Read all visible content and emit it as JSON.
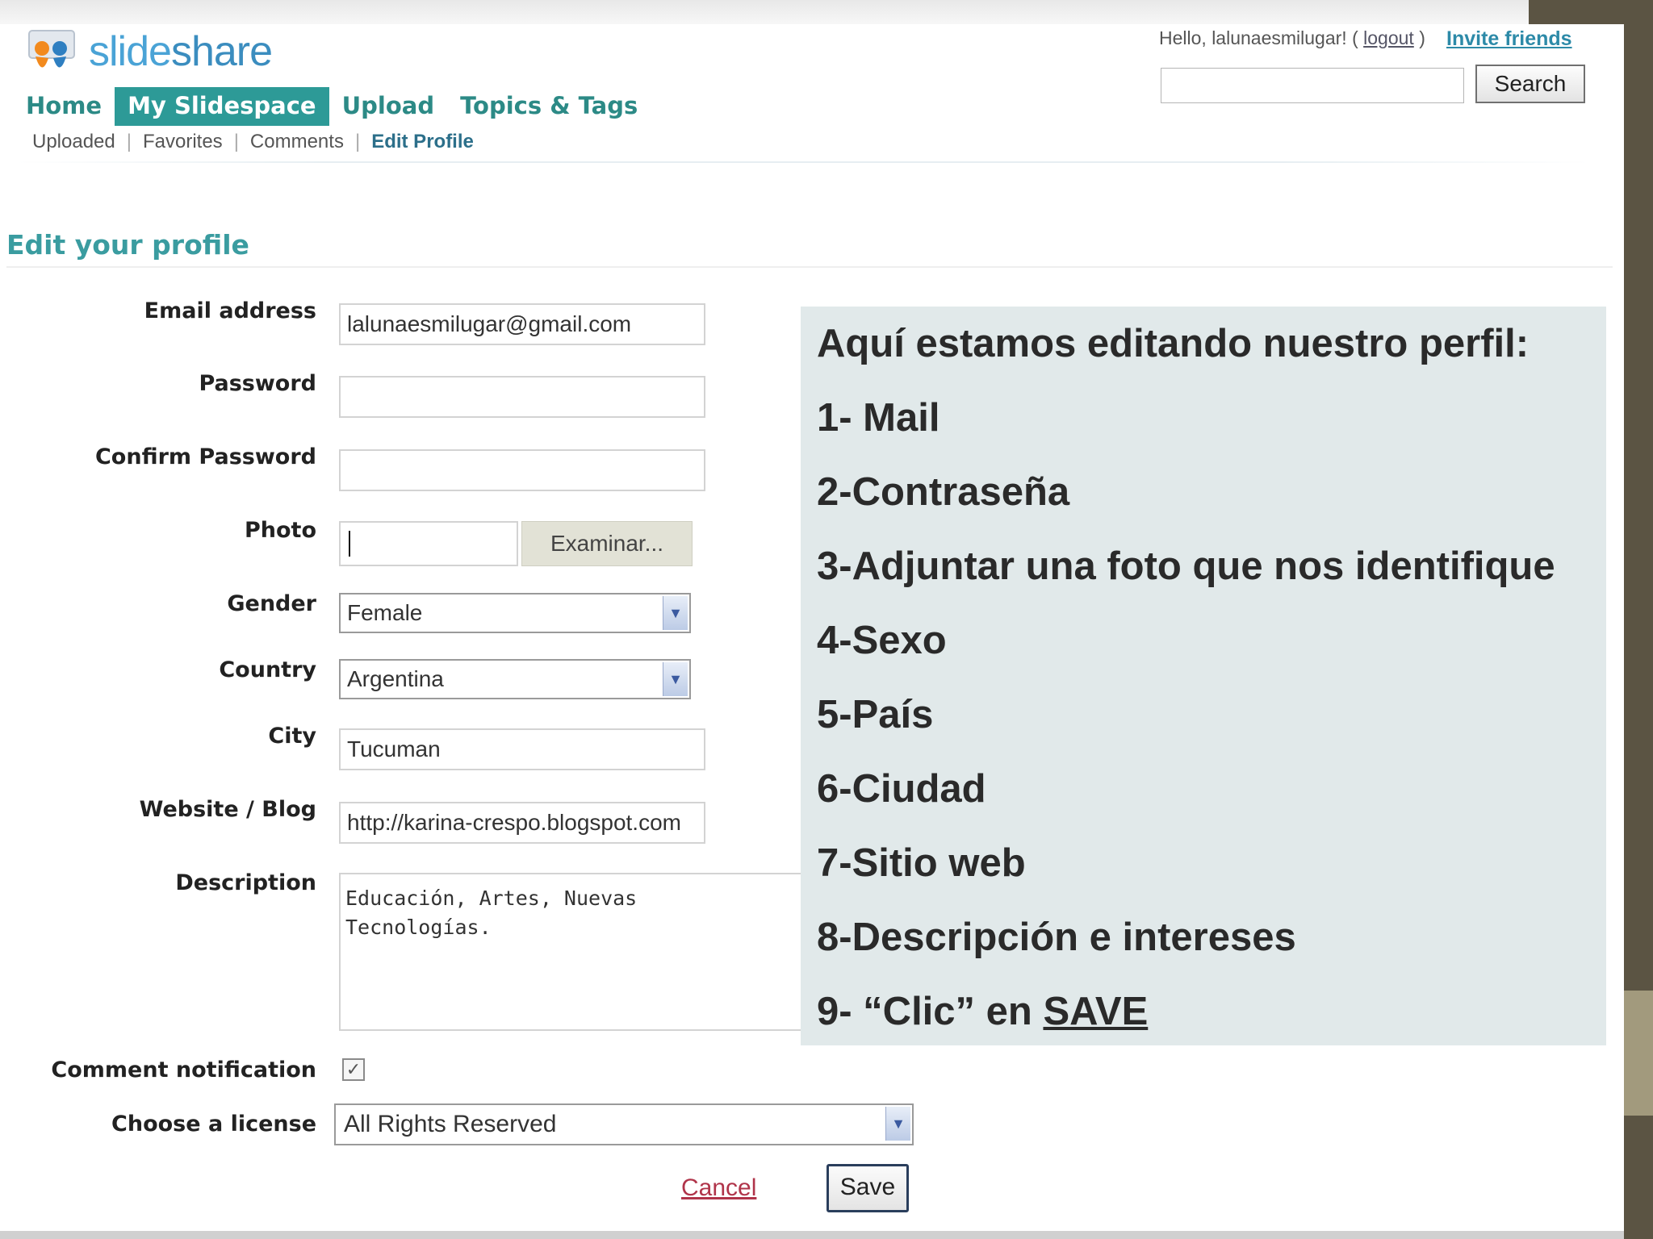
{
  "header": {
    "brand": {
      "prefix": "slide",
      "suffix": "share"
    },
    "greeting": "Hello, lalunaesmilugar! (",
    "logout": "logout",
    "greeting_close": ")",
    "invite": "Invite friends",
    "search_button": "Search",
    "search_value": ""
  },
  "nav": {
    "tabs": [
      "Home",
      "My Slidespace",
      "Upload",
      "Topics & Tags"
    ],
    "active": "My Slidespace",
    "subnav": [
      "Uploaded",
      "Favorites",
      "Comments",
      "Edit Profile"
    ]
  },
  "page": {
    "title": "Edit your profile"
  },
  "form": {
    "email_label": "Email address",
    "email_value": "lalunaesmilugar@gmail.com",
    "password_label": "Password",
    "password_value": "",
    "confirm_label": "Confirm Password",
    "confirm_value": "",
    "photo_label": "Photo",
    "browse_button": "Examinar...",
    "gender_label": "Gender",
    "gender_value": "Female",
    "country_label": "Country",
    "country_value": "Argentina",
    "city_label": "City",
    "city_value": "Tucuman",
    "website_label": "Website / Blog",
    "website_value": "http://karina-crespo.blogspot.com",
    "description_label": "Description",
    "description_value": "Educación, Artes, Nuevas\nTecnologías.",
    "comment_label": "Comment notification",
    "comment_checked": true,
    "license_label": "Choose a license",
    "license_value": "All Rights Reserved",
    "cancel": "Cancel",
    "save": "Save"
  },
  "annotation": {
    "title": "Aquí estamos editando nuestro perfil:",
    "steps": [
      "1- Mail",
      "2-Contraseña",
      "3-Adjuntar una foto que nos identifique",
      "4-Sexo",
      "5-País",
      "6-Ciudad",
      "7-Sitio web",
      "8-Descripción e intereses"
    ],
    "last_step_prefix": "9- “Clic” en ",
    "last_step_emphasis": "SAVE"
  },
  "icons": {
    "logo": "slideshare-logo-icon",
    "dropdown": "chevron-down-icon",
    "check": "checkmark-icon"
  },
  "colors": {
    "nav_active": "#2d9a97",
    "accent": "#3a9ca0",
    "panel": "#e1e9ea",
    "frame": "#5b5443"
  }
}
